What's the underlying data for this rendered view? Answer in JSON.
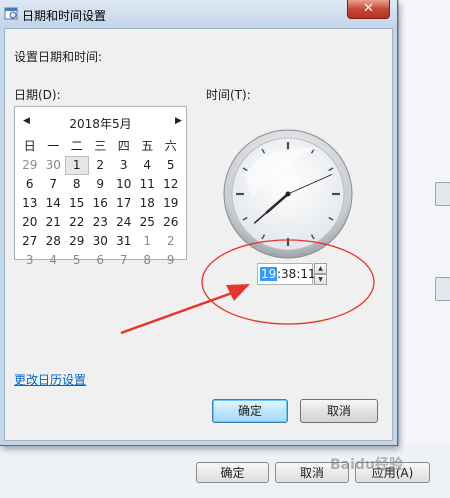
{
  "dialog": {
    "title": "日期和时间设置",
    "heading": "设置日期和时间:",
    "date_label": "日期(D):",
    "time_label": "时间(T):",
    "calendar": {
      "month_title": "2018年5月",
      "weekdays": [
        "日",
        "一",
        "二",
        "三",
        "四",
        "五",
        "六"
      ],
      "weeks": [
        [
          "29",
          "30",
          "1",
          "2",
          "3",
          "4",
          "5"
        ],
        [
          "6",
          "7",
          "8",
          "9",
          "10",
          "11",
          "12"
        ],
        [
          "13",
          "14",
          "15",
          "16",
          "17",
          "18",
          "19"
        ],
        [
          "20",
          "21",
          "22",
          "23",
          "24",
          "25",
          "26"
        ],
        [
          "27",
          "28",
          "29",
          "30",
          "31",
          "1",
          "2"
        ],
        [
          "3",
          "4",
          "5",
          "6",
          "7",
          "8",
          "9"
        ]
      ],
      "today": "1"
    },
    "time": {
      "hour": "19",
      "rest": ":38:11"
    },
    "calendar_link": "更改日历设置",
    "ok_label": "确定",
    "cancel_label": "取消"
  },
  "parent_window": {
    "ok_label": "确定",
    "cancel_label": "取消",
    "apply_label": "应用(A)"
  },
  "watermark": "Baidu经验",
  "colors": {
    "annotation": "#e8342a",
    "link": "#0066cc",
    "selection": "#3399ff"
  }
}
